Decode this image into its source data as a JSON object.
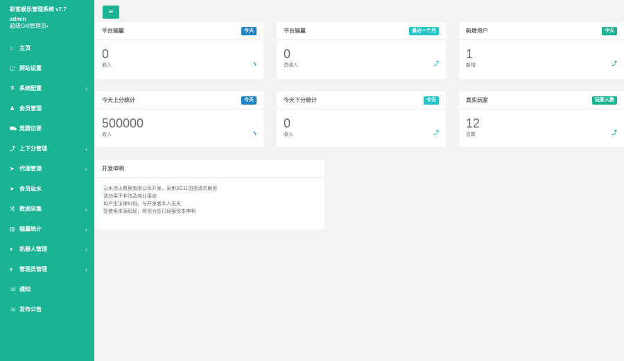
{
  "sidebar": {
    "title": "彩客娱乐管理系统 v7.7",
    "user": "admin",
    "role": "超级GM管理员",
    "items": [
      {
        "icon": "⌂",
        "label": "主页",
        "chevron": ""
      },
      {
        "icon": "◫",
        "label": "网站设置",
        "chevron": ""
      },
      {
        "icon": "⚗",
        "label": "系统配置",
        "chevron": "‹"
      },
      {
        "icon": "♟",
        "label": "会员管理",
        "chevron": ""
      },
      {
        "icon": "⛟",
        "label": "竞猜记录",
        "chevron": ""
      },
      {
        "icon": "⤴",
        "label": "上下分管理",
        "chevron": "‹"
      },
      {
        "icon": "➤",
        "label": "代理管理",
        "chevron": "‹"
      },
      {
        "icon": "➤",
        "label": "会员返水",
        "chevron": ""
      },
      {
        "icon": "⤨",
        "label": "数据采集",
        "chevron": "‹"
      },
      {
        "icon": "▥",
        "label": "输赢统计",
        "chevron": "‹"
      },
      {
        "icon": "♦",
        "label": "机器人管理",
        "chevron": "‹"
      },
      {
        "icon": "♦",
        "label": "管理员管理",
        "chevron": "‹"
      },
      {
        "icon": "☏",
        "label": "通知",
        "chevron": ""
      },
      {
        "icon": "☏",
        "label": "发布公告",
        "chevron": ""
      }
    ]
  },
  "header": {
    "toggle_icon": "≡"
  },
  "cards": [
    {
      "title": "平台输赢",
      "badge": "今天",
      "badge_color": "#1c84c6",
      "value": "0",
      "sub": "收入",
      "trend": "ϟ",
      "trend_color": "#1c84c6"
    },
    {
      "title": "平台输赢",
      "badge": "最近一个月",
      "badge_color": "#23c6c8",
      "value": "0",
      "sub": "总收入",
      "trend": "⤴",
      "trend_color": "#23c6c8"
    },
    {
      "title": "新增用户",
      "badge": "今天",
      "badge_color": "#1ab394",
      "value": "1",
      "sub": "新增",
      "trend": "⤴",
      "trend_color": "#1ab394"
    },
    {
      "title": "今天上分统计",
      "badge": "今天",
      "badge_color": "#1c84c6",
      "value": "500000",
      "sub": "收入",
      "trend": "ϟ",
      "trend_color": "#1c84c6"
    },
    {
      "title": "今天下分统计",
      "badge": "今天",
      "badge_color": "#23c6c8",
      "value": "0",
      "sub": "收入",
      "trend": "⤴",
      "trend_color": "#23c6c8"
    },
    {
      "title": "真实玩家",
      "badge": "玩家人数",
      "badge_color": "#1ab394",
      "value": "12",
      "sub": "总数",
      "trend": "⤴",
      "trend_color": "#1ab394"
    }
  ],
  "notice": {
    "title": "开发申明",
    "lines": [
      "云水流火数据有限公司开发，采用SG11加密请勿解密",
      "请勿用于非法及商业用途",
      "如产生法律纠纷，与开发者本人无关",
      "您使用本源码起，将视为您已经接受本申明"
    ]
  }
}
